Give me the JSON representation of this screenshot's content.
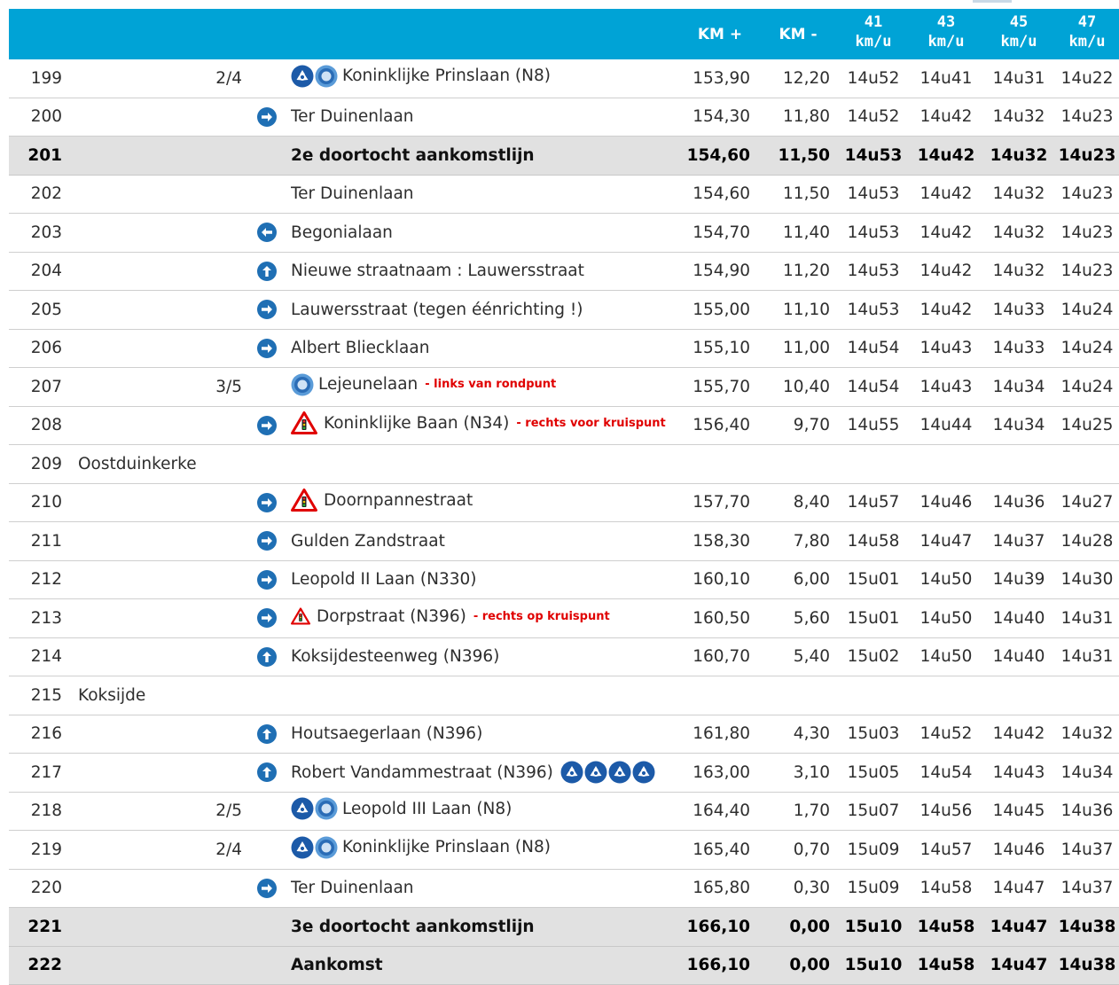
{
  "header": {
    "km_plus": "KM +",
    "km_min": "KM -",
    "speeds": [
      {
        "value": "41",
        "unit": "km/u"
      },
      {
        "value": "43",
        "unit": "km/u"
      },
      {
        "value": "45",
        "unit": "km/u"
      },
      {
        "value": "47",
        "unit": "km/u"
      }
    ]
  },
  "rows": [
    {
      "n": "199",
      "place": "",
      "frac": "2/4",
      "dir": "",
      "pre": [
        "rb-blue",
        "rb-round"
      ],
      "street": "Koninklijke Prinslaan (N8)",
      "post": [],
      "note": "",
      "kp": "153,90",
      "km": "12,20",
      "t": [
        "14u52",
        "14u41",
        "14u31",
        "14u22"
      ],
      "hl": false
    },
    {
      "n": "200",
      "place": "",
      "frac": "",
      "dir": "right",
      "pre": [],
      "street": "Ter Duinenlaan",
      "post": [],
      "note": "",
      "kp": "154,30",
      "km": "11,80",
      "t": [
        "14u52",
        "14u42",
        "14u32",
        "14u23"
      ],
      "hl": false
    },
    {
      "n": "201",
      "place": "",
      "frac": "",
      "dir": "",
      "pre": [],
      "street": "2e doortocht aankomstlijn",
      "post": [],
      "note": "",
      "kp": "154,60",
      "km": "11,50",
      "t": [
        "14u53",
        "14u42",
        "14u32",
        "14u23"
      ],
      "hl": true
    },
    {
      "n": "202",
      "place": "",
      "frac": "",
      "dir": "",
      "pre": [],
      "street": "Ter Duinenlaan",
      "post": [],
      "note": "",
      "kp": "154,60",
      "km": "11,50",
      "t": [
        "14u53",
        "14u42",
        "14u32",
        "14u23"
      ],
      "hl": false
    },
    {
      "n": "203",
      "place": "",
      "frac": "",
      "dir": "left",
      "pre": [],
      "street": "Begonialaan",
      "post": [],
      "note": "",
      "kp": "154,70",
      "km": "11,40",
      "t": [
        "14u53",
        "14u42",
        "14u32",
        "14u23"
      ],
      "hl": false
    },
    {
      "n": "204",
      "place": "",
      "frac": "",
      "dir": "up",
      "pre": [],
      "street": "Nieuwe straatnaam : Lauwersstraat",
      "post": [],
      "note": "",
      "kp": "154,90",
      "km": "11,20",
      "t": [
        "14u53",
        "14u42",
        "14u32",
        "14u23"
      ],
      "hl": false
    },
    {
      "n": "205",
      "place": "",
      "frac": "",
      "dir": "right",
      "pre": [],
      "street": "Lauwersstraat (tegen éénrichting !)",
      "post": [],
      "note": "",
      "kp": "155,00",
      "km": "11,10",
      "t": [
        "14u53",
        "14u42",
        "14u33",
        "14u24"
      ],
      "hl": false
    },
    {
      "n": "206",
      "place": "",
      "frac": "",
      "dir": "right",
      "pre": [],
      "street": "Albert Bliecklaan",
      "post": [],
      "note": "",
      "kp": "155,10",
      "km": "11,00",
      "t": [
        "14u54",
        "14u43",
        "14u33",
        "14u24"
      ],
      "hl": false
    },
    {
      "n": "207",
      "place": "",
      "frac": "3/5",
      "dir": "",
      "pre": [
        "rb-round"
      ],
      "street": "Lejeunelaan",
      "post": [],
      "note": "- links van rondpunt",
      "kp": "155,70",
      "km": "10,40",
      "t": [
        "14u54",
        "14u43",
        "14u34",
        "14u24"
      ],
      "hl": false
    },
    {
      "n": "208",
      "place": "",
      "frac": "",
      "dir": "right",
      "pre": [
        "warn"
      ],
      "street": "Koninklijke Baan (N34)",
      "post": [],
      "note": "- rechts voor kruispunt",
      "kp": "156,40",
      "km": "9,70",
      "t": [
        "14u55",
        "14u44",
        "14u34",
        "14u25"
      ],
      "hl": false
    },
    {
      "n": "209",
      "place": "Oostduinkerke",
      "frac": "",
      "dir": "",
      "pre": [],
      "street": "",
      "post": [],
      "note": "",
      "kp": "",
      "km": "",
      "t": [
        "",
        "",
        "",
        ""
      ],
      "hl": false
    },
    {
      "n": "210",
      "place": "",
      "frac": "",
      "dir": "right",
      "pre": [
        "warn"
      ],
      "street": "Doornpannestraat",
      "post": [],
      "note": "",
      "kp": "157,70",
      "km": "8,40",
      "t": [
        "14u57",
        "14u46",
        "14u36",
        "14u27"
      ],
      "hl": false
    },
    {
      "n": "211",
      "place": "",
      "frac": "",
      "dir": "right",
      "pre": [],
      "street": "Gulden Zandstraat",
      "post": [],
      "note": "",
      "kp": "158,30",
      "km": "7,80",
      "t": [
        "14u58",
        "14u47",
        "14u37",
        "14u28"
      ],
      "hl": false
    },
    {
      "n": "212",
      "place": "",
      "frac": "",
      "dir": "right",
      "pre": [],
      "street": "Leopold II Laan (N330)",
      "post": [],
      "note": "",
      "kp": "160,10",
      "km": "6,00",
      "t": [
        "15u01",
        "14u50",
        "14u39",
        "14u30"
      ],
      "hl": false
    },
    {
      "n": "213",
      "place": "",
      "frac": "",
      "dir": "right",
      "pre": [
        "warn-small"
      ],
      "street": "Dorpstraat (N396)",
      "post": [],
      "note": "- rechts op kruispunt",
      "kp": "160,50",
      "km": "5,60",
      "t": [
        "15u01",
        "14u50",
        "14u40",
        "14u31"
      ],
      "hl": false
    },
    {
      "n": "214",
      "place": "",
      "frac": "",
      "dir": "up",
      "pre": [],
      "street": "Koksijdesteenweg (N396)",
      "post": [],
      "note": "",
      "kp": "160,70",
      "km": "5,40",
      "t": [
        "15u02",
        "14u50",
        "14u40",
        "14u31"
      ],
      "hl": false
    },
    {
      "n": "215",
      "place": "Koksijde",
      "frac": "",
      "dir": "",
      "pre": [],
      "street": "",
      "post": [],
      "note": "",
      "kp": "",
      "km": "",
      "t": [
        "",
        "",
        "",
        ""
      ],
      "hl": false
    },
    {
      "n": "216",
      "place": "",
      "frac": "",
      "dir": "up",
      "pre": [],
      "street": "Houtsaegerlaan (N396)",
      "post": [],
      "note": "",
      "kp": "161,80",
      "km": "4,30",
      "t": [
        "15u03",
        "14u52",
        "14u42",
        "14u32"
      ],
      "hl": false
    },
    {
      "n": "217",
      "place": "",
      "frac": "",
      "dir": "up",
      "pre": [],
      "street": "Robert Vandammestraat (N396)",
      "post": [
        "rb-blue",
        "rb-blue",
        "rb-blue",
        "rb-blue"
      ],
      "note": "",
      "kp": "163,00",
      "km": "3,10",
      "t": [
        "15u05",
        "14u54",
        "14u43",
        "14u34"
      ],
      "hl": false
    },
    {
      "n": "218",
      "place": "",
      "frac": "2/5",
      "dir": "",
      "pre": [
        "rb-blue",
        "rb-round"
      ],
      "street": "Leopold III Laan (N8)",
      "post": [],
      "note": "",
      "kp": "164,40",
      "km": "1,70",
      "t": [
        "15u07",
        "14u56",
        "14u45",
        "14u36"
      ],
      "hl": false
    },
    {
      "n": "219",
      "place": "",
      "frac": "2/4",
      "dir": "",
      "pre": [
        "rb-blue",
        "rb-round"
      ],
      "street": "Koninklijke Prinslaan (N8)",
      "post": [],
      "note": "",
      "kp": "165,40",
      "km": "0,70",
      "t": [
        "15u09",
        "14u57",
        "14u46",
        "14u37"
      ],
      "hl": false
    },
    {
      "n": "220",
      "place": "",
      "frac": "",
      "dir": "right",
      "pre": [],
      "street": "Ter Duinenlaan",
      "post": [],
      "note": "",
      "kp": "165,80",
      "km": "0,30",
      "t": [
        "15u09",
        "14u58",
        "14u47",
        "14u37"
      ],
      "hl": false
    },
    {
      "n": "221",
      "place": "",
      "frac": "",
      "dir": "",
      "pre": [],
      "street": "3e doortocht aankomstlijn",
      "post": [],
      "note": "",
      "kp": "166,10",
      "km": "0,00",
      "t": [
        "15u10",
        "14u58",
        "14u47",
        "14u38"
      ],
      "hl": true
    },
    {
      "n": "222",
      "place": "",
      "frac": "",
      "dir": "",
      "pre": [],
      "street": "Aankomst",
      "post": [],
      "note": "",
      "kp": "166,10",
      "km": "0,00",
      "t": [
        "15u10",
        "14u58",
        "14u47",
        "14u38"
      ],
      "hl": true
    }
  ],
  "colors": {
    "header_bg": "#00a3d6",
    "highlight_row_bg": "#e1e1e1",
    "direction_icon": "#1f6fb4",
    "roundabout_icon": "#1c5aa8",
    "warning_red": "#e00000"
  }
}
